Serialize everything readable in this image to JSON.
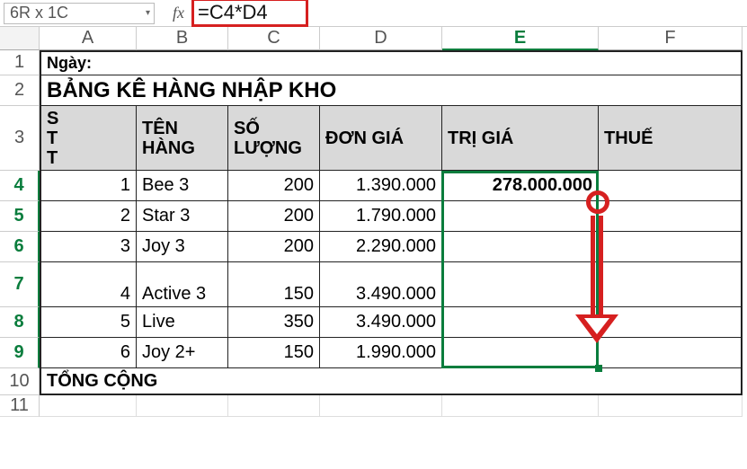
{
  "formula_bar": {
    "name_box": "6R x 1C",
    "fx": "fx",
    "formula": "=C4*D4"
  },
  "columns": [
    "A",
    "B",
    "C",
    "D",
    "E",
    "F"
  ],
  "row_headers": [
    "1",
    "2",
    "3",
    "4",
    "5",
    "6",
    "7",
    "8",
    "9",
    "10",
    "11"
  ],
  "row1_label": "Ngày:",
  "row2_title": "BẢNG KÊ HÀNG NHẬP KHO",
  "headers": {
    "stt": "S\nT\nT",
    "ten": "TÊN HÀNG",
    "sl": "SỐ LƯỢNG",
    "dg": "ĐƠN GIÁ",
    "tg": "TRỊ GIÁ",
    "thue": "THUẾ"
  },
  "rows": [
    {
      "stt": "1",
      "ten": "Bee 3",
      "sl": "200",
      "dg": "1.390.000",
      "tg": "278.000.000"
    },
    {
      "stt": "2",
      "ten": "Star 3",
      "sl": "200",
      "dg": "1.790.000",
      "tg": ""
    },
    {
      "stt": "3",
      "ten": "Joy 3",
      "sl": "200",
      "dg": "2.290.000",
      "tg": ""
    },
    {
      "stt": "4",
      "ten": "Active 3",
      "sl": "150",
      "dg": "3.490.000",
      "tg": ""
    },
    {
      "stt": "5",
      "ten": "Live",
      "sl": "350",
      "dg": "3.490.000",
      "tg": ""
    },
    {
      "stt": "6",
      "ten": "Joy 2+",
      "sl": "150",
      "dg": "1.990.000",
      "tg": ""
    }
  ],
  "total_label": "TỔNG CỘNG",
  "chart_data": {
    "type": "table",
    "title": "BẢNG KÊ HÀNG NHẬP KHO",
    "columns": [
      "STT",
      "TÊN HÀNG",
      "SỐ LƯỢNG",
      "ĐƠN GIÁ",
      "TRỊ GIÁ",
      "THUẾ"
    ],
    "rows": [
      [
        1,
        "Bee 3",
        200,
        1390000,
        278000000,
        null
      ],
      [
        2,
        "Star 3",
        200,
        1790000,
        null,
        null
      ],
      [
        3,
        "Joy 3",
        200,
        2290000,
        null,
        null
      ],
      [
        4,
        "Active 3",
        150,
        3490000,
        null,
        null
      ],
      [
        5,
        "Live",
        350,
        3490000,
        null,
        null
      ],
      [
        6,
        "Joy 2+",
        150,
        1990000,
        null,
        null
      ]
    ],
    "formula_E4": "=C4*D4"
  }
}
